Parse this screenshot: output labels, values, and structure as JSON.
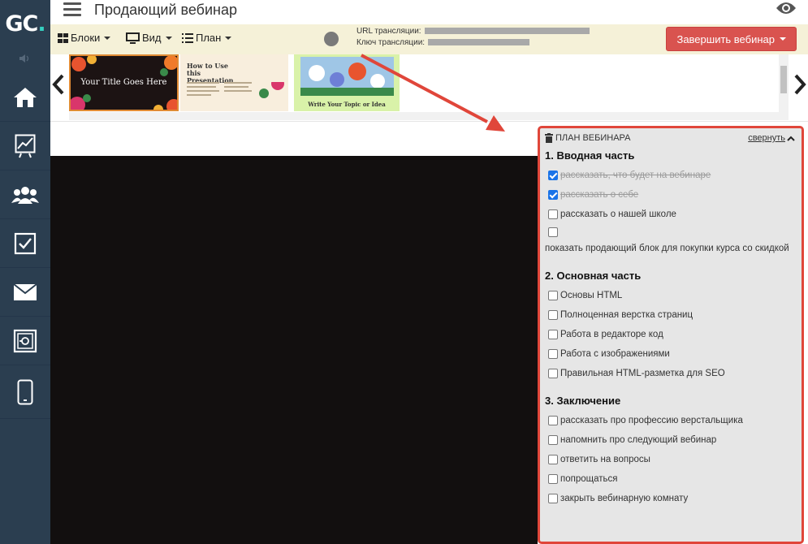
{
  "app": {
    "logo_main": "GC",
    "logo_accent": ".",
    "page_title": "Продающий вебинар"
  },
  "sidebar": {
    "items": [
      {
        "icon": "home-icon"
      },
      {
        "icon": "chart-icon"
      },
      {
        "icon": "users-icon"
      },
      {
        "icon": "tasks-icon"
      },
      {
        "icon": "mail-icon"
      },
      {
        "icon": "safe-icon"
      },
      {
        "icon": "mobile-icon"
      }
    ]
  },
  "toolbar": {
    "blocks_label": "Блоки",
    "view_label": "Вид",
    "plan_label": "План",
    "url_label": "URL трансляции:",
    "key_label": "Ключ трансляции:",
    "end_button_label": "Завершить вебинар"
  },
  "slides": {
    "slide1_text": "Your Title Goes Here",
    "slide2_text": "How to Use this Presentation",
    "slide3_text": "Write Your Topic or Idea"
  },
  "plan": {
    "header_title": "ПЛАН ВЕБИНАРА",
    "collapse_label": "свернуть",
    "sections": [
      {
        "title": "1. Вводная часть",
        "items": [
          {
            "label": "рассказать, что будет на вебинаре",
            "checked": true
          },
          {
            "label": "рассказать о себе",
            "checked": true
          },
          {
            "label": "рассказать о нашей школе",
            "checked": false
          },
          {
            "label": "показать продающий блок для покупки курса со скидкой",
            "checked": false
          }
        ]
      },
      {
        "title": "2. Основная часть",
        "items": [
          {
            "label": "Основы HTML",
            "checked": false
          },
          {
            "label": "Полноценная верстка страниц",
            "checked": false
          },
          {
            "label": "Работа в редакторе код",
            "checked": false
          },
          {
            "label": "Работа с изображениями",
            "checked": false
          },
          {
            "label": "Правильная HTML-разметка для SEO",
            "checked": false
          }
        ]
      },
      {
        "title": "3. Заключение",
        "items": [
          {
            "label": "рассказать про профессию верстальщика",
            "checked": false
          },
          {
            "label": "напомнить про следующий вебинар",
            "checked": false
          },
          {
            "label": "ответить на вопросы",
            "checked": false
          },
          {
            "label": "попрощаться",
            "checked": false
          },
          {
            "label": "закрыть вебинарную комнату",
            "checked": false
          }
        ]
      }
    ]
  },
  "colors": {
    "sidebar_bg": "#2b3e50",
    "toolbar_bg": "#f5f1d8",
    "end_button_bg": "#d9534f",
    "highlight_border": "#e0463a",
    "video_bg": "#120f0f"
  }
}
